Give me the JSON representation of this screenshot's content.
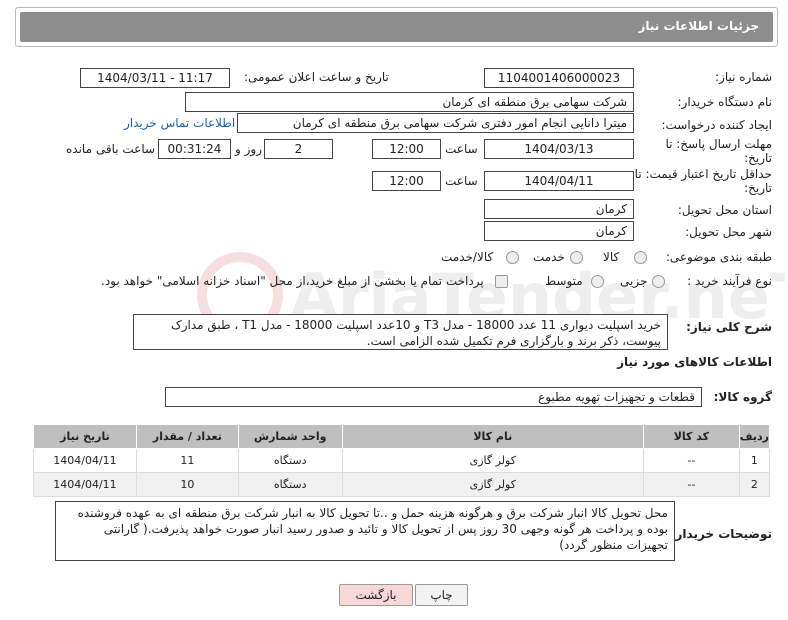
{
  "header": {
    "title": "جزئیات اطلاعات نیاز"
  },
  "fields": {
    "need_number_label": "شماره نیاز:",
    "need_number": "1104001406000023",
    "announce_label": "تاریخ و ساعت اعلان عمومی:",
    "announce_value": "1404/03/11 - 11:17",
    "buyer_org_label": "نام دستگاه خریدار:",
    "buyer_org": "شرکت سهامی برق منطقه ای کرمان",
    "creator_label": "ایجاد کننده درخواست:",
    "creator": "میترا دانایی انجام امور دفتری شرکت سهامی برق منطقه ای کرمان",
    "contact_link": "اطلاعات تماس خریدار",
    "deadline_label": "مهلت ارسال پاسخ: تا تاریخ:",
    "deadline_date": "1404/03/13",
    "time_label": "ساعت",
    "deadline_time": "12:00",
    "days_value": "2",
    "days_label": "روز و",
    "remaining_time": "00:31:24",
    "remaining_label": "ساعت باقی مانده",
    "price_valid_label": "حداقل تاریخ اعتبار قیمت: تا تاریخ:",
    "price_valid_date": "1404/04/11",
    "price_valid_time": "12:00",
    "province_label": "استان محل تحویل:",
    "province": "کرمان",
    "city_label": "شهر محل تحویل:",
    "city": "کرمان",
    "category_label": "طبقه بندی موضوعی:",
    "category_options": [
      "کالا",
      "خدمت",
      "کالا/خدمت"
    ],
    "process_label": "نوع فرآیند خرید :",
    "process_options": [
      "جزیی",
      "متوسط"
    ],
    "payment_note": "پرداخت تمام یا بخشی از مبلغ خرید،از محل \"اسناد خزانه اسلامی\" خواهد بود."
  },
  "description": {
    "label": "شرح کلی نیاز:",
    "text": "خرید اسپلیت دیواری 11 عدد 18000 - مدل T3  و 10عدد اسپلیت 18000 - مدل T1 ، طبق مدارک پیوست، ذکر برند و بارگزاری فرم تکمیل شده الزامی است."
  },
  "goods_info": {
    "title": "اطلاعات کالاهای مورد نیاز",
    "group_label": "گروه کالا:",
    "group_value": "قطعات و تجهیزات تهویه مطبوع"
  },
  "table": {
    "headers": [
      "ردیف",
      "کد کالا",
      "نام کالا",
      "واحد شمارش",
      "تعداد / مقدار",
      "تاریخ نیاز"
    ],
    "rows": [
      [
        "1",
        "--",
        "کولر گازی",
        "دستگاه",
        "11",
        "1404/04/11"
      ],
      [
        "2",
        "--",
        "کولر گازی",
        "دستگاه",
        "10",
        "1404/04/11"
      ]
    ]
  },
  "notes": {
    "label": "توضیحات خریدار:",
    "text": "محل تحویل کالا انبار شرکت برق و هرگونه هزینه حمل و ..تا تحویل کالا به انبار شرکت برق منطقه ای به عهده فروشنده بوده و پرداخت هر گونه وجهی 30 روز پس از تحویل کالا و تائید و صدور رسید انبار صورت خواهد پذیرفت.( گارانتی تجهیزات منظور گردد)"
  },
  "buttons": {
    "print": "چاپ",
    "back": "بازگشت"
  },
  "watermark": {
    "text": "AriaTender.neT"
  },
  "colors": {
    "header_bg": "#8d8d8d",
    "link": "#1a5fb4",
    "back_button": "#f7d7d7"
  }
}
